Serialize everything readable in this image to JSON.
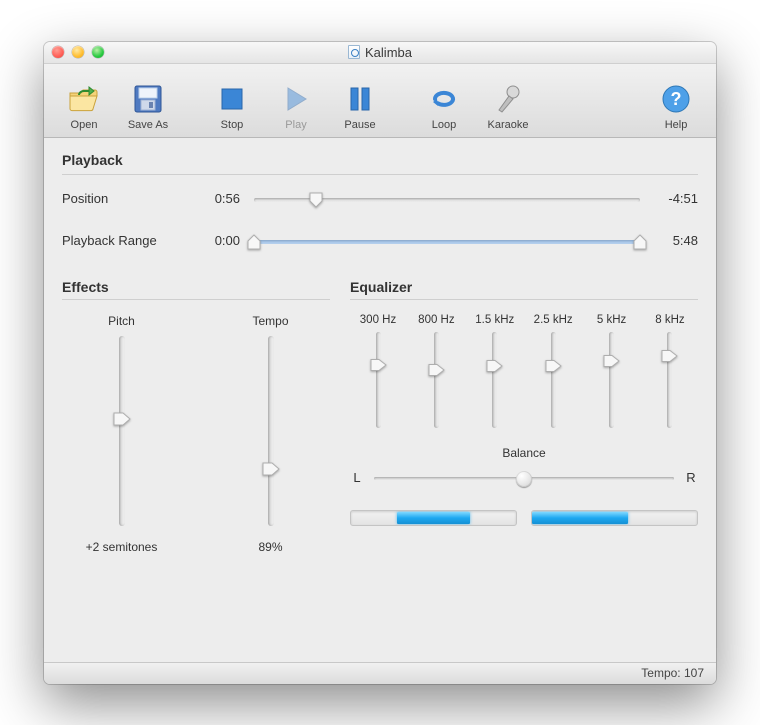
{
  "title": "Kalimba",
  "toolbar": {
    "open": "Open",
    "save_as": "Save As",
    "stop": "Stop",
    "play": "Play",
    "pause": "Pause",
    "loop": "Loop",
    "karaoke": "Karaoke",
    "help": "Help"
  },
  "sections": {
    "playback": "Playback",
    "effects": "Effects",
    "equalizer": "Equalizer"
  },
  "playback": {
    "position_label": "Position",
    "position_elapsed": "0:56",
    "position_remaining": "-4:51",
    "position_percent": 16,
    "range_label": "Playback Range",
    "range_start": "0:00",
    "range_end": "5:48",
    "range_low_percent": 0,
    "range_high_percent": 100
  },
  "effects": {
    "pitch_label": "Pitch",
    "pitch_value": "+2 semitones",
    "pitch_percent": 44,
    "tempo_label": "Tempo",
    "tempo_value": "89%",
    "tempo_percent": 70
  },
  "equalizer": {
    "bands": [
      {
        "label": "300 Hz",
        "percent": 35
      },
      {
        "label": "800 Hz",
        "percent": 40
      },
      {
        "label": "1.5 kHz",
        "percent": 36
      },
      {
        "label": "2.5 kHz",
        "percent": 36
      },
      {
        "label": "5 kHz",
        "percent": 31
      },
      {
        "label": "8 kHz",
        "percent": 26
      }
    ],
    "balance_label": "Balance",
    "balance_left": "L",
    "balance_right": "R",
    "balance_percent": 50,
    "meters": [
      {
        "start": 28,
        "end": 72
      },
      {
        "start": 0,
        "end": 58
      }
    ]
  },
  "statusbar": {
    "tempo_text": "Tempo: 107"
  },
  "colors": {
    "accent_blue": "#3b86d6",
    "track_blue": "#b2cdef",
    "meter_blue": "#1ea8f0"
  }
}
